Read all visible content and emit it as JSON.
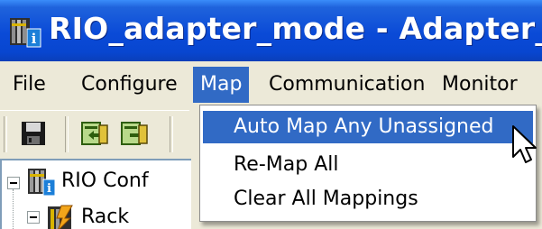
{
  "window": {
    "title": "RIO_adapter_mode - Adapter_mode.r"
  },
  "menubar": {
    "items": [
      {
        "label": "File"
      },
      {
        "label": "Configure"
      },
      {
        "label": "Map"
      },
      {
        "label": "Communication"
      },
      {
        "label": "Monitor"
      }
    ],
    "active": "Map"
  },
  "toolbar": {
    "buttons": [
      {
        "icon": "save-icon"
      },
      {
        "icon": "upload-icon"
      },
      {
        "icon": "download-icon"
      }
    ]
  },
  "tree": {
    "root_label": "RIO Conf",
    "child_label": "Rack"
  },
  "map_menu": {
    "items": [
      {
        "label": "Auto Map Any Unassigned",
        "highlighted": true
      },
      {
        "label": "Re-Map All",
        "highlighted": false
      },
      {
        "label": "Clear All Mappings",
        "highlighted": false
      }
    ]
  },
  "colors": {
    "titlebar": "#0a4ad7",
    "highlight": "#316ac5",
    "chrome": "#ece9d8"
  }
}
